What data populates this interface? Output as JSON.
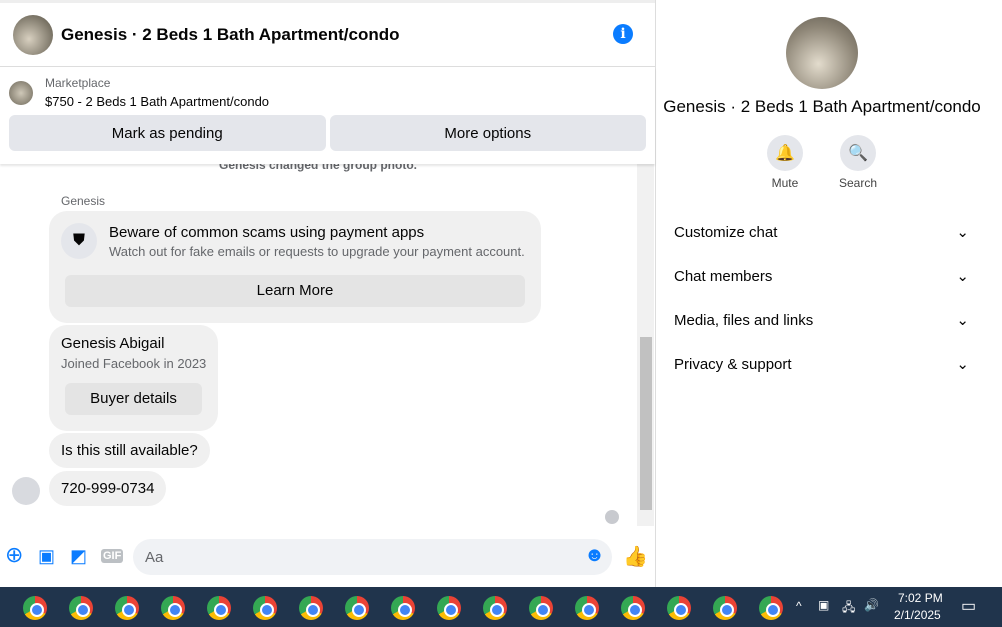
{
  "header": {
    "title": "Genesis · 2 Beds 1 Bath Apartment/condo",
    "info_icon": "i"
  },
  "listing": {
    "source": "Marketplace",
    "title": "$750 - 2 Beds 1 Bath Apartment/condo",
    "mark_pending": "Mark as pending",
    "more_options": "More options"
  },
  "chat": {
    "system_msg": "Genesis changed the group photo.",
    "sender": "Genesis",
    "scam_title": "Beware of common scams using payment apps",
    "scam_body": "Watch out for fake emails or requests to upgrade your payment account.",
    "learn_more": "Learn More",
    "buyer_name": "Genesis Abigail",
    "buyer_joined": "Joined Facebook in 2023",
    "buyer_details": "Buyer details",
    "msg1": "Is this still available?",
    "msg2": "720-999-0734"
  },
  "composer": {
    "placeholder": "Aa",
    "gif": "GIF"
  },
  "panel": {
    "title": "Genesis · 2 Beds 1 Bath Apartment/condo",
    "mute": "Mute",
    "search": "Search",
    "sections": [
      "Customize chat",
      "Chat members",
      "Media, files and links",
      "Privacy & support"
    ]
  },
  "taskbar": {
    "time": "7:02 PM",
    "date": "2/1/2025",
    "app_count": 17,
    "accent": "#0a7cff"
  }
}
